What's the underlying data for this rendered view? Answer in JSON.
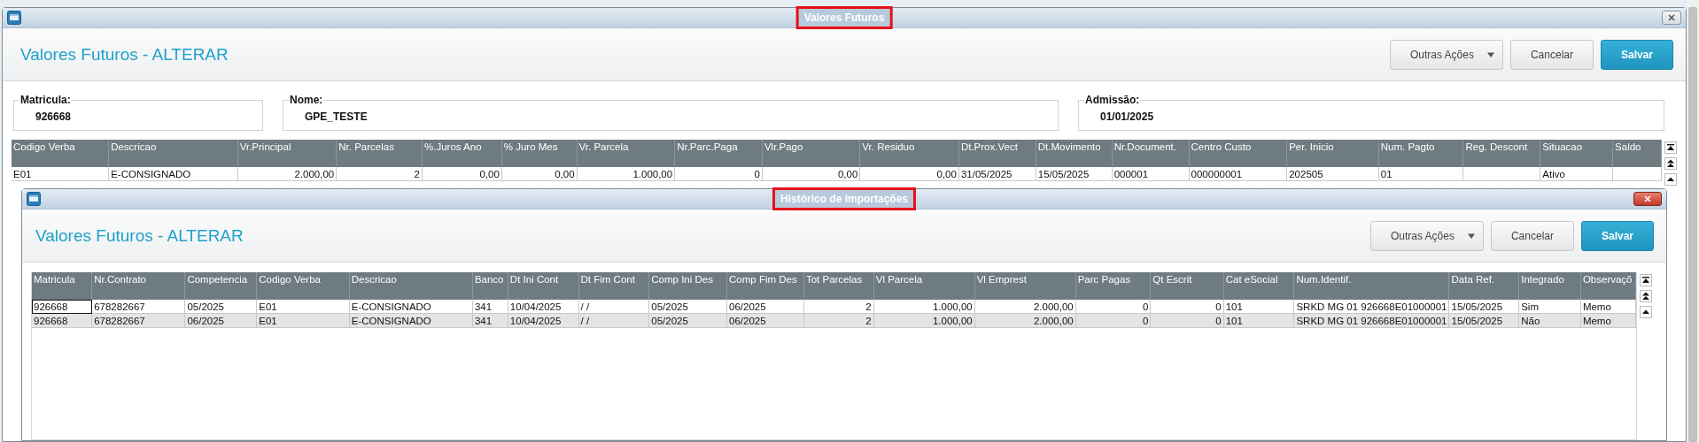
{
  "outer_window": {
    "title": "Valores Futuros",
    "title_highlighted": true,
    "heading": "Valores Futuros - ALTERAR",
    "buttons": [
      {
        "label": "Outras Ações",
        "kind": "menu"
      },
      {
        "label": "Cancelar",
        "kind": "secondary"
      },
      {
        "label": "Salvar",
        "kind": "primary"
      }
    ],
    "fields": [
      {
        "label": "Matricula:",
        "value": "926668"
      },
      {
        "label": "Nome:",
        "value": "GPE_TESTE"
      },
      {
        "label": "Admissão:",
        "value": "01/01/2025"
      }
    ],
    "grid": {
      "columns": [
        "Codigo Verba",
        "Descricao",
        "Vr.Principal",
        "Nr. Parcelas",
        "%.Juros Ano",
        "% Juro Mes",
        "Vr. Parcela",
        "Nr.Parc.Paga",
        "Vlr.Pago",
        "Vr. Residuo",
        "Dt.Prox.Vect",
        "Dt.Movimento",
        "Nr.Document.",
        "Centro Custo",
        "Per. Inicio",
        "Num. Pagto",
        "Reg. Descont",
        "Situacao",
        "Saldo"
      ],
      "rows": [
        {
          "selected": false,
          "cells": [
            "E01",
            "E-CONSIGNADO",
            "2.000,00",
            "2",
            "0,00",
            "0,00",
            "1.000,00",
            "0",
            "0,00",
            "0,00",
            "31/05/2025",
            "15/05/2025",
            "000001",
            "000000001",
            "202505",
            "01",
            null,
            "Ativo",
            null
          ]
        }
      ]
    }
  },
  "inner_window": {
    "title": "Histórico de Importações",
    "title_highlighted": true,
    "heading": "Valores Futuros - ALTERAR",
    "buttons": [
      {
        "label": "Outras Ações",
        "kind": "menu"
      },
      {
        "label": "Cancelar",
        "kind": "secondary"
      },
      {
        "label": "Salvar",
        "kind": "primary"
      }
    ],
    "grid": {
      "columns": [
        "Matricula",
        "Nr.Contrato",
        "Competencia",
        "Codigo Verba",
        "Descricao",
        "Banco",
        "Dt Ini Cont",
        "Dt Fim Cont",
        "Comp Ini Des",
        "Comp Fim Des",
        "Tot Parcelas",
        "Vl Parcela",
        "Vl Emprest",
        "Parc Pagas",
        "Qt Escrit",
        "Cat eSocial",
        "Num.Identif.",
        "Data Ref.",
        "Integrado",
        "Observaçõ"
      ],
      "rows": [
        {
          "selected": true,
          "cells": [
            "926668",
            "678282667",
            "05/2025",
            "E01",
            "E-CONSIGNADO",
            "341",
            "10/04/2025",
            "/ /",
            "05/2025",
            "06/2025",
            "2",
            "1.000,00",
            "2.000,00",
            "0",
            "0",
            "101",
            "SRKD MG 01 926668E01000001",
            "15/05/2025",
            "Sim",
            "Memo"
          ]
        },
        {
          "selected": false,
          "cells": [
            "926668",
            "678282667",
            "06/2025",
            "E01",
            "E-CONSIGNADO",
            "341",
            "10/04/2025",
            "/ /",
            "05/2025",
            "06/2025",
            "2",
            "1.000,00",
            "2.000,00",
            "0",
            "0",
            "101",
            "SRKD MG 01 926668E01000001",
            "15/05/2025",
            "Não",
            "Memo"
          ]
        }
      ]
    }
  }
}
